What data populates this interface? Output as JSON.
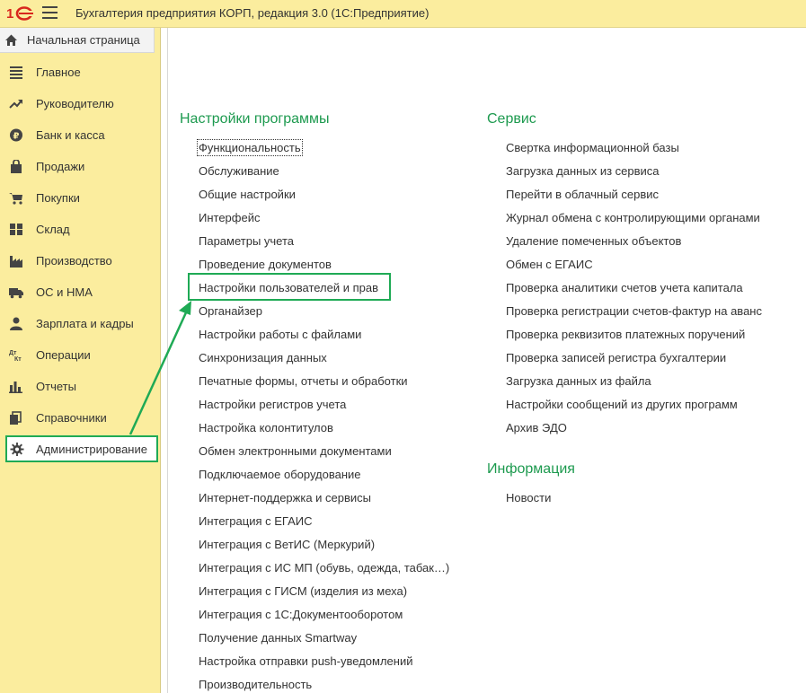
{
  "app": {
    "title": "Бухгалтерия предприятия КОРП, редакция 3.0  (1С:Предприятие)",
    "logo_icon": "1c-logo-icon",
    "menu_icon": "hamburger-icon"
  },
  "sidebar": {
    "home": {
      "label": "Начальная страница",
      "icon": "home-icon"
    },
    "items": [
      {
        "label": "Главное",
        "icon": "list-icon"
      },
      {
        "label": "Руководителю",
        "icon": "trend-icon"
      },
      {
        "label": "Банк и касса",
        "icon": "ruble-icon"
      },
      {
        "label": "Продажи",
        "icon": "shopping-bag-icon"
      },
      {
        "label": "Покупки",
        "icon": "cart-icon"
      },
      {
        "label": "Склад",
        "icon": "grid-icon"
      },
      {
        "label": "Производство",
        "icon": "factory-icon"
      },
      {
        "label": "ОС и НМА",
        "icon": "truck-icon"
      },
      {
        "label": "Зарплата и кадры",
        "icon": "person-icon"
      },
      {
        "label": "Операции",
        "icon": "dt-kt-icon"
      },
      {
        "label": "Отчеты",
        "icon": "bar-chart-icon"
      },
      {
        "label": "Справочники",
        "icon": "books-icon"
      },
      {
        "label": "Администрирование",
        "icon": "gear-icon",
        "active": true
      }
    ]
  },
  "content": {
    "program_settings": {
      "title": "Настройки программы",
      "links": [
        "Функциональность",
        "Обслуживание",
        "Общие настройки",
        "Интерфейс",
        "Параметры учета",
        "Проведение документов",
        "Настройки пользователей и прав",
        "Органайзер",
        "Настройки работы с файлами",
        "Синхронизация данных",
        "Печатные формы, отчеты и обработки",
        "Настройки регистров учета",
        "Настройка колонтитулов",
        "Обмен электронными документами",
        "Подключаемое оборудование",
        "Интернет-поддержка и сервисы",
        "Интеграция с ЕГАИС",
        "Интеграция с ВетИС (Меркурий)",
        "Интеграция с ИС МП (обувь, одежда, табак…)",
        "Интеграция с ГИСМ (изделия из меха)",
        "Интеграция с 1С:Документооборотом",
        "Получение данных Smartway",
        "Настройка отправки push-уведомлений",
        "Производительность"
      ]
    },
    "service": {
      "title": "Сервис",
      "links": [
        "Свертка информационной базы",
        "Загрузка данных из сервиса",
        "Перейти в облачный сервис",
        "Журнал обмена с контролирующими органами",
        "Удаление помеченных объектов",
        "Обмен с ЕГАИС",
        "Проверка аналитики счетов учета капитала",
        "Проверка регистрации счетов-фактур на аванс",
        "Проверка реквизитов платежных поручений",
        "Проверка записей регистра бухгалтерии",
        "Загрузка данных из файла",
        "Настройки сообщений из других программ",
        "Архив ЭДО"
      ]
    },
    "info": {
      "title": "Информация",
      "links": [
        "Новости"
      ]
    }
  },
  "colors": {
    "accent_green": "#1d9a4f",
    "highlight_green": "#1faa55",
    "panel_yellow": "#fbed9e",
    "logo_red": "#d8261d"
  }
}
